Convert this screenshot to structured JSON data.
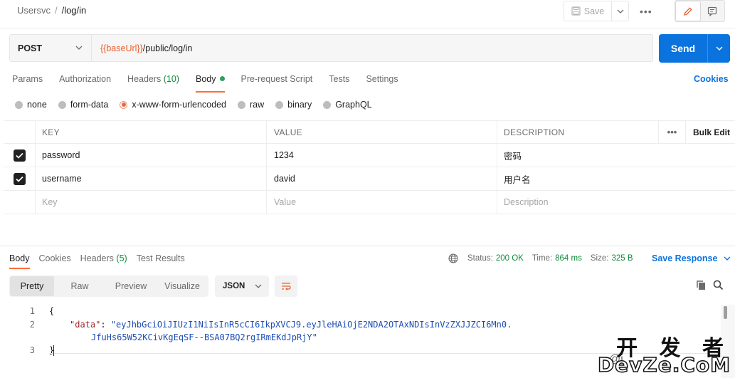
{
  "header": {
    "breadcrumb_parent": "Usersvc",
    "breadcrumb_sep": "/",
    "breadcrumb_current": "/log/in",
    "save_label": "Save",
    "more": "•••"
  },
  "request": {
    "method": "POST",
    "url_var": "{{baseUrl}}",
    "url_path": "/public/log/in",
    "send_label": "Send"
  },
  "tabs": {
    "params": "Params",
    "authorization": "Authorization",
    "headers": "Headers",
    "headers_count": "(10)",
    "body": "Body",
    "prerequest": "Pre-request Script",
    "tests": "Tests",
    "settings": "Settings",
    "cookies": "Cookies"
  },
  "body_types": [
    "none",
    "form-data",
    "x-www-form-urlencoded",
    "raw",
    "binary",
    "GraphQL"
  ],
  "table": {
    "headers": {
      "key": "KEY",
      "value": "VALUE",
      "description": "DESCRIPTION",
      "more": "•••",
      "bulk_edit": "Bulk Edit"
    },
    "rows": [
      {
        "key": "password",
        "value": "1234",
        "description": "密码"
      },
      {
        "key": "username",
        "value": "david",
        "description": "用户名"
      }
    ],
    "placeholder": {
      "key": "Key",
      "value": "Value",
      "description": "Description"
    }
  },
  "response": {
    "tabs": {
      "body": "Body",
      "cookies": "Cookies",
      "headers": "Headers",
      "headers_count": "(5)",
      "test_results": "Test Results"
    },
    "status_label": "Status:",
    "status_value": "200 OK",
    "time_label": "Time:",
    "time_value": "864 ms",
    "size_label": "Size:",
    "size_value": "325 B",
    "save_response": "Save Response",
    "formats": [
      "Pretty",
      "Raw",
      "Preview",
      "Visualize"
    ],
    "language": "JSON",
    "code": {
      "line1_no": "1",
      "line2_no": "2",
      "line3_no": "3",
      "open_brace": "{",
      "close_brace": "}",
      "key": "\"data\"",
      "colon": ": ",
      "value_part1": "\"eyJhbGciOiJIUzI1NiIsInR5cCI6IkpXVCJ9.eyJleHAiOjE2NDA2OTAxNDIsInVzZXJJZCI6Mn0.",
      "value_part2": "JfuHs65W52KCivKgEqSF--BSA07BQ2rgIRmEKdJpRjY\""
    }
  },
  "watermark": {
    "top": "开 发 者",
    "bottom": "DevZe.CoM",
    "at": "@i"
  },
  "colors": {
    "accent": "#ff6c37",
    "primary": "#0b73de",
    "success": "#0e8c3a"
  }
}
